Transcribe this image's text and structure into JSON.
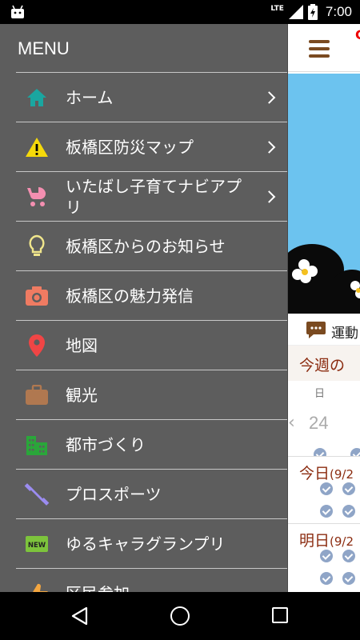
{
  "status_bar": {
    "network": "LTE",
    "time": "7:00"
  },
  "drawer": {
    "title": "MENU",
    "items": [
      {
        "label": "ホーム",
        "icon": "home-icon",
        "has_arrow": true
      },
      {
        "label": "板橋区防災マップ",
        "icon": "warning-icon",
        "has_arrow": true
      },
      {
        "label": "いたばし子育てナビアプリ",
        "icon": "stroller-icon",
        "has_arrow": true
      },
      {
        "label": "板橋区からのお知らせ",
        "icon": "lightbulb-icon",
        "has_arrow": false
      },
      {
        "label": "板橋区の魅力発信",
        "icon": "camera-icon",
        "has_arrow": false
      },
      {
        "label": "地図",
        "icon": "map-pin-icon",
        "has_arrow": false
      },
      {
        "label": "観光",
        "icon": "briefcase-icon",
        "has_arrow": false
      },
      {
        "label": "都市づくり",
        "icon": "building-icon",
        "has_arrow": false
      },
      {
        "label": "プロスポーツ",
        "icon": "dumbbell-icon",
        "has_arrow": false
      },
      {
        "label": "ゆるキャラグランプリ",
        "icon": "new-badge-icon",
        "has_arrow": false
      },
      {
        "label": "区民参加",
        "icon": "thumbs-up-icon",
        "has_arrow": false
      }
    ]
  },
  "background": {
    "undo_text": "運動",
    "week_title": "今週の",
    "week_day_label": "日",
    "cal_date": "24",
    "today_label": "今日",
    "today_date": "(9/2",
    "tomorrow_label": "明日",
    "tomorrow_date": "(9/2"
  },
  "colors": {
    "drawer_bg": "#5d5d5d",
    "accent_brown": "#8b2b0f",
    "sky": "#6cc3ef"
  }
}
